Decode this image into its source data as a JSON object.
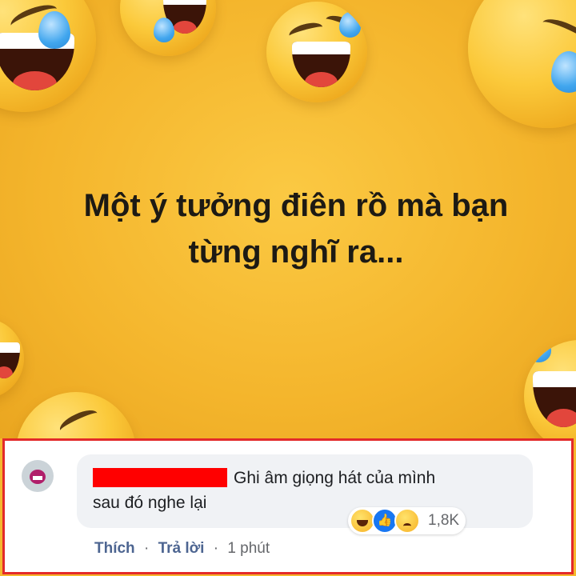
{
  "post": {
    "headline_line1": "Một ý tưởng điên rồ mà bạn",
    "headline_line2": "từng nghĩ ra..."
  },
  "comment": {
    "text_line1": "Ghi âm giọng hát của mình",
    "text_line2": "sau đó nghe lại",
    "reaction_count": "1,8K",
    "reactions": [
      "haha-icon",
      "like-icon",
      "sad-icon"
    ],
    "like_label": "Thích",
    "separator": "·",
    "reply_label": "Trả lời",
    "time": "1 phút"
  },
  "colors": {
    "highlight_border": "#e32a2a",
    "redaction": "#ff0000",
    "poster_background": "#f5b82e",
    "bubble": "#f0f2f5"
  }
}
